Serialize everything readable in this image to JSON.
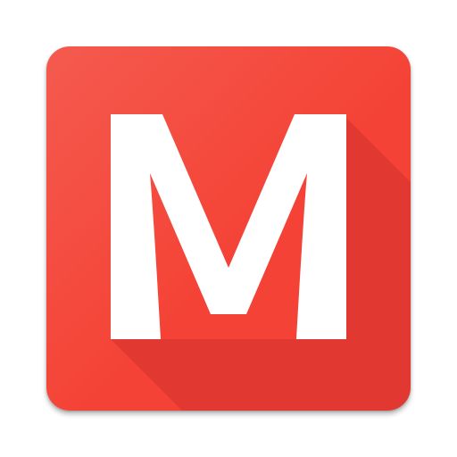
{
  "icon": {
    "name": "app-icon",
    "letter": "M",
    "colors": {
      "tile": "#f44336",
      "long_shadow": "#d32f2f",
      "letter": "#ffffff"
    }
  }
}
